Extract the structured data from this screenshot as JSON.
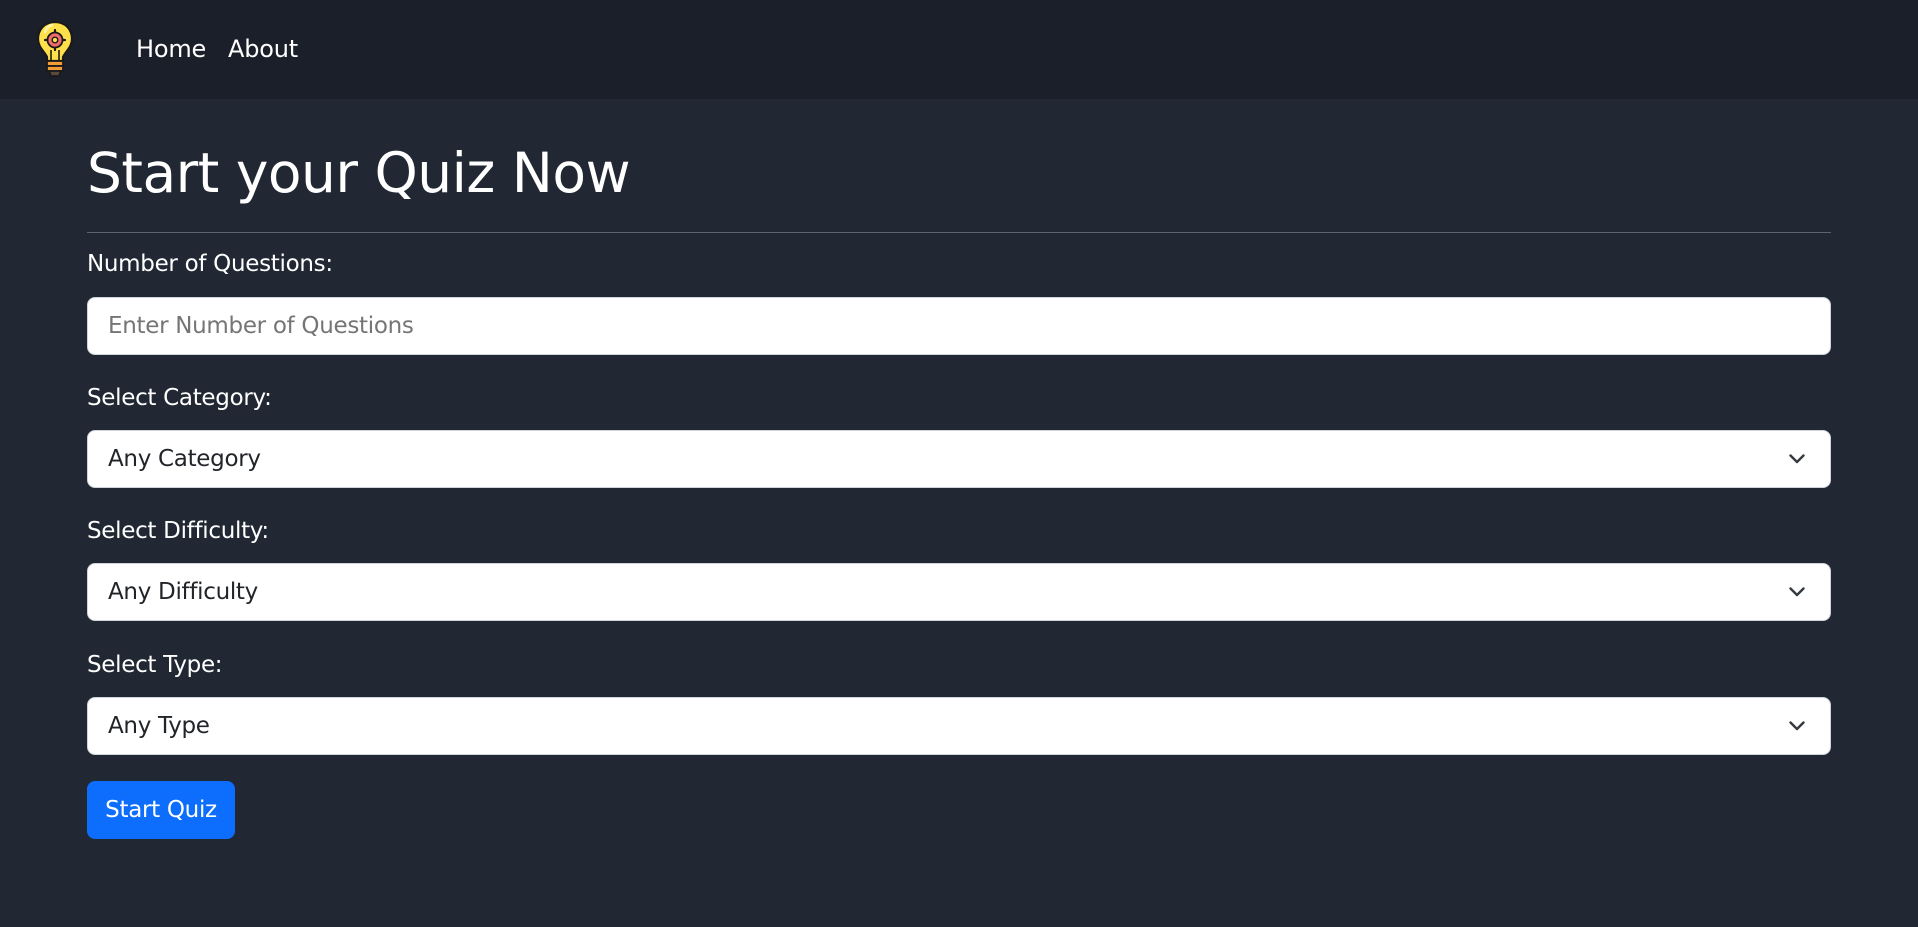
{
  "nav": {
    "logo_icon": "lightbulb-gear-icon",
    "links": [
      "Home",
      "About"
    ]
  },
  "main": {
    "title": "Start your Quiz Now",
    "fields": {
      "questions": {
        "label": "Number of Questions:",
        "placeholder": "Enter Number of Questions",
        "value": ""
      },
      "category": {
        "label": "Select Category:",
        "selected": "Any Category",
        "icon": "chevron-down-icon"
      },
      "difficulty": {
        "label": "Select Difficulty:",
        "selected": "Any Difficulty",
        "icon": "chevron-down-icon"
      },
      "type": {
        "label": "Select Type:",
        "selected": "Any Type",
        "icon": "chevron-down-icon"
      }
    },
    "submit_label": "Start Quiz"
  },
  "colors": {
    "page_bg": "#212733",
    "navbar_bg": "#1b1f2a",
    "accent": "#0d6efd"
  }
}
